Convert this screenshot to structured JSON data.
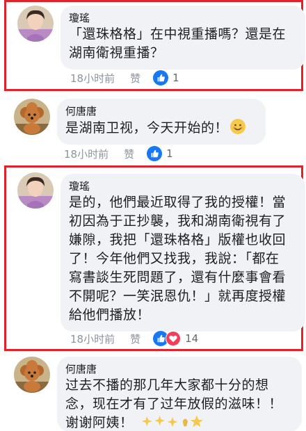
{
  "comments": [
    {
      "author": "瓊瑤",
      "lines": [
        "「還珠格格」在中視重播嗎？還是在",
        "湖南衛視重播？"
      ],
      "time": "18小时前",
      "like_label": "赞",
      "reaction_count": "1"
    },
    {
      "author": "何唐唐",
      "lines": [
        "是湖南卫视，今天开始的！"
      ],
      "time": "18小时前",
      "like_label": "赞",
      "reaction_count": "1"
    },
    {
      "author": "瓊瑤",
      "lines": [
        "是的，他們最近取得了我的授權！當",
        "初因為于正抄襲，我和湖南衛視有了",
        "嫌隙，我把「還珠格格」版權也收回",
        "了！今年他們又找我，我說：「都在",
        "寫書談生死問題了，還有什麼事會看",
        "不開呢？一笑泯恩仇！」就再度授權",
        "給他們播放！"
      ],
      "time": "18小时前",
      "like_label": "赞",
      "reaction_count": "14"
    },
    {
      "author": "何唐唐",
      "lines": [
        "过去不播的那几年大家都十分的想",
        "念，现在才有了过年放假的滋味！！",
        "谢谢阿姨！"
      ]
    }
  ],
  "colors": {
    "highlight_border": "#e0232b",
    "bubble_bg": "#f0f2f5",
    "like_blue": "#1877f2",
    "love_red": "#f33e58"
  },
  "icons": [
    "thumbs-up-icon",
    "heart-icon",
    "smiling-face-emoji",
    "sparkles-emoji",
    "star-emoji"
  ]
}
